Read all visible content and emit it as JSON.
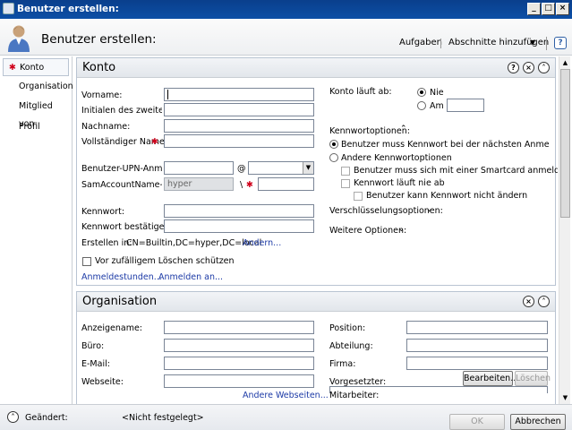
{
  "window": {
    "title": "Benutzer erstellen:"
  },
  "header": {
    "title": "Benutzer erstellen:",
    "tasks_link": "Aufgaben",
    "sections_link": "Abschnitte hinzufügen",
    "help": "?"
  },
  "nav": {
    "items": [
      {
        "label": "Konto",
        "required": "✱"
      },
      {
        "label": "Organisation"
      },
      {
        "label": "Mitglied von"
      },
      {
        "label": "Profil"
      }
    ]
  },
  "konto": {
    "title": "Konto",
    "fields": {
      "vorname": "Vorname:",
      "initialen": "Initialen des zweiten...",
      "nachname": "Nachname:",
      "vollstaendig": "Vollständiger Name:",
      "upn": "Benutzer-UPN-Anmel...",
      "sam": "SamAccountName-A...",
      "sam_value": "hyper",
      "sam_sep": "\\",
      "at": "@",
      "kennwort": "Kennwort:",
      "kennwort_bestaetigen": "Kennwort bestätigen:",
      "erstellen_in_label": "Erstellen in:",
      "erstellen_in_value": "CN=Builtin,DC=hyper,DC=local",
      "aendern": "Ändern...",
      "schutz": "Vor zufälligem Löschen schützen",
      "anmeldestunden": "Anmeldestunden...",
      "anmelden_an": "Anmelden an...",
      "required": "✱"
    },
    "konto_laeuft_ab": {
      "label": "Konto läuft ab:",
      "nie": "Nie",
      "am": "Am"
    },
    "kennwortoptionen": {
      "label": "Kennwortoptionen:",
      "opt1": "Benutzer muss Kennwort bei der nächsten Anmeldung ä...",
      "opt2": "Andere Kennwortoptionen",
      "smartcard": "Benutzer muss sich mit einer Smartcard anmelden",
      "nie_ab": "Kennwort läuft nie ab",
      "nicht_aendern": "Benutzer kann Kennwort nicht ändern"
    },
    "verschluesselung": "Verschlüsselungsoptionen:",
    "weitere": "Weitere Optionen:"
  },
  "organisation": {
    "title": "Organisation",
    "anzeigename": "Anzeigename:",
    "buero": "Büro:",
    "email": "E-Mail:",
    "webseite": "Webseite:",
    "andere_webseiten": "Andere Webseiten...",
    "position": "Position:",
    "abteilung": "Abteilung:",
    "firma": "Firma:",
    "vorgesetzter": "Vorgesetzter:",
    "bearbeiten": "Bearbeiten...",
    "loeschen": "Löschen",
    "mitarbeiter": "Mitarbeiter:"
  },
  "footer": {
    "geaendert_label": "Geändert:",
    "geaendert_value": "<Nicht festgelegt>",
    "ok": "OK",
    "abbrechen": "Abbrechen"
  }
}
